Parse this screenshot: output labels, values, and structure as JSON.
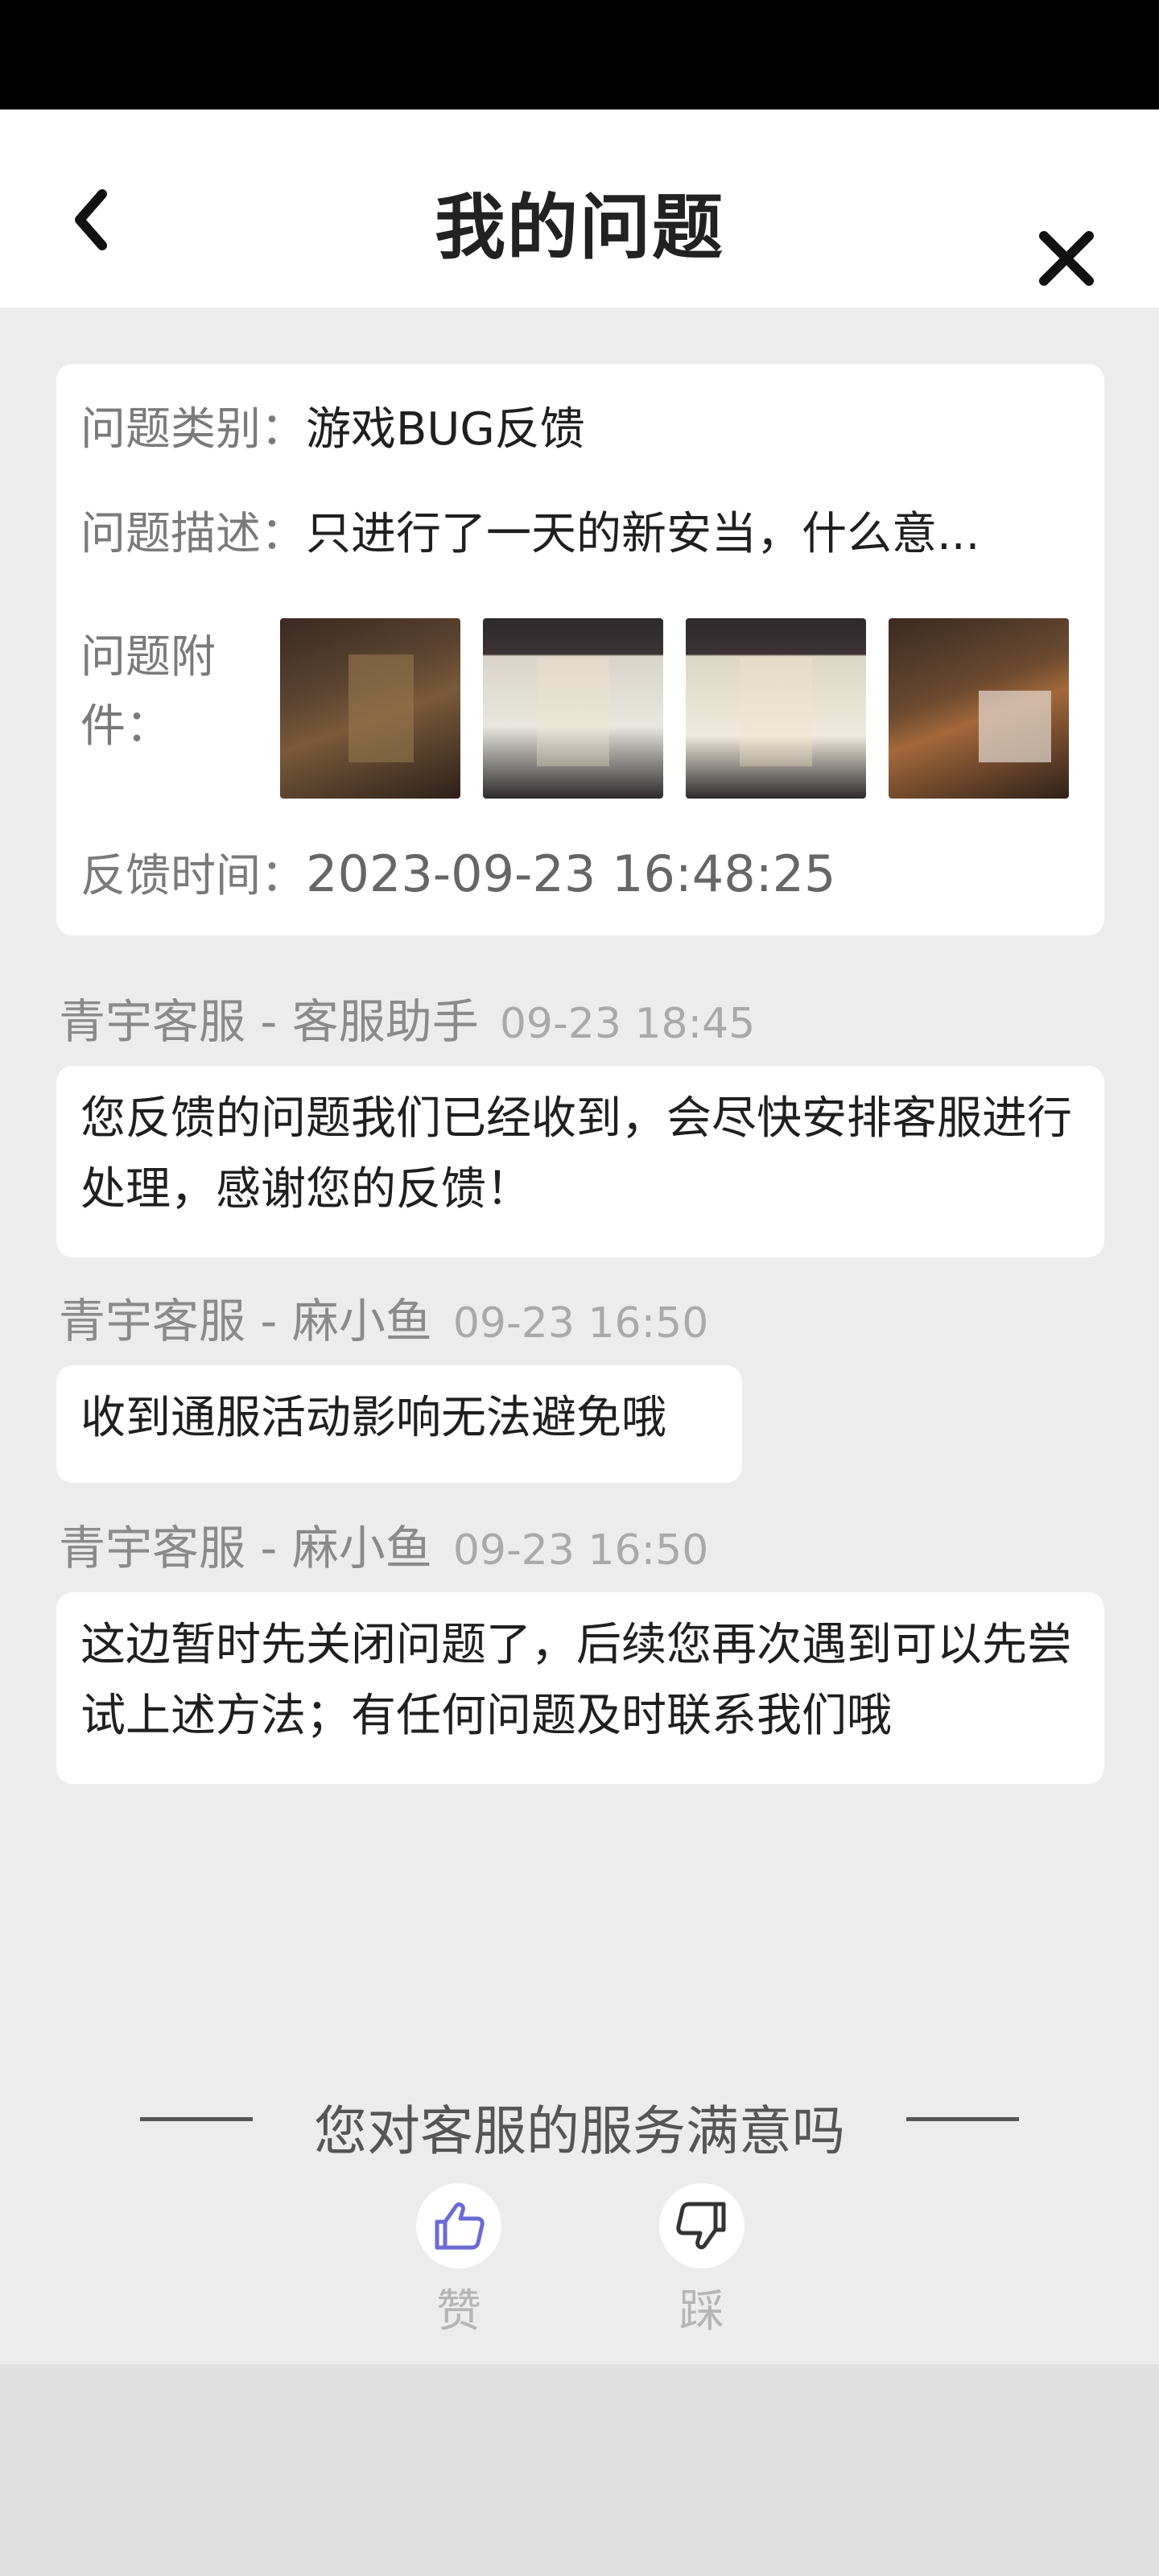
{
  "header": {
    "title": "我的问题"
  },
  "info": {
    "category_label": "问题类别：",
    "category_value": "游戏BUG反馈",
    "desc_label": "问题描述：",
    "desc_value": "只进行了一天的新安当，什么意...",
    "attach_label": "问题附件：",
    "time_label": "反馈时间：",
    "time_value": "2023-09-23 16:48:25"
  },
  "messages": [
    {
      "sender": "青宇客服 - 客服助手",
      "time": "09-23 18:45",
      "text": "您反馈的问题我们已经收到，会尽快安排客服进行处理，感谢您的反馈！"
    },
    {
      "sender": "青宇客服 - 麻小鱼",
      "time": "09-23 16:50",
      "text": "收到通服活动影响无法避免哦"
    },
    {
      "sender": "青宇客服 - 麻小鱼",
      "time": "09-23 16:50",
      "text": "这边暂时先关闭问题了，后续您再次遇到可以先尝试上述方法；有任何问题及时联系我们哦"
    }
  ],
  "rating": {
    "title": "您对客服的服务满意吗",
    "like_label": "赞",
    "dislike_label": "踩"
  },
  "colors": {
    "accent": "#6b6bd6",
    "background": "#ececec"
  },
  "icons": {
    "back": "chevron-left-icon",
    "close": "close-icon",
    "like": "thumbs-up-icon",
    "dislike": "thumbs-down-icon"
  }
}
